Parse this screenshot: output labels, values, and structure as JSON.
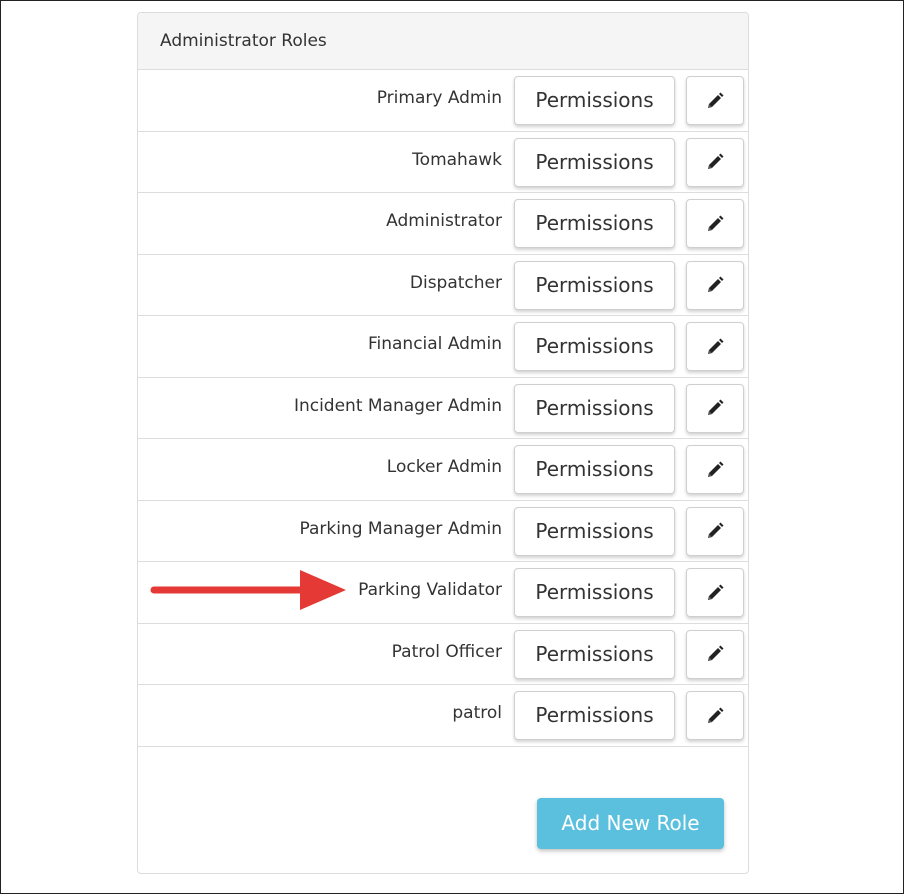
{
  "panel": {
    "title": "Administrator Roles"
  },
  "roles": [
    {
      "name": "Primary Admin",
      "permissions_label": "Permissions"
    },
    {
      "name": "Tomahawk",
      "permissions_label": "Permissions"
    },
    {
      "name": "Administrator",
      "permissions_label": "Permissions"
    },
    {
      "name": "Dispatcher",
      "permissions_label": "Permissions"
    },
    {
      "name": "Financial Admin",
      "permissions_label": "Permissions"
    },
    {
      "name": "Incident Manager Admin",
      "permissions_label": "Permissions"
    },
    {
      "name": "Locker Admin",
      "permissions_label": "Permissions"
    },
    {
      "name": "Parking Manager Admin",
      "permissions_label": "Permissions"
    },
    {
      "name": "Parking Validator",
      "permissions_label": "Permissions"
    },
    {
      "name": "Patrol Officer",
      "permissions_label": "Permissions"
    },
    {
      "name": "patrol",
      "permissions_label": "Permissions"
    }
  ],
  "actions": {
    "add_role_label": "Add New Role"
  },
  "icons": {
    "edit": "pencil-icon",
    "annotation": "red-arrow-icon"
  },
  "colors": {
    "add_button": "#5bc0de",
    "arrow": "#e53935"
  }
}
